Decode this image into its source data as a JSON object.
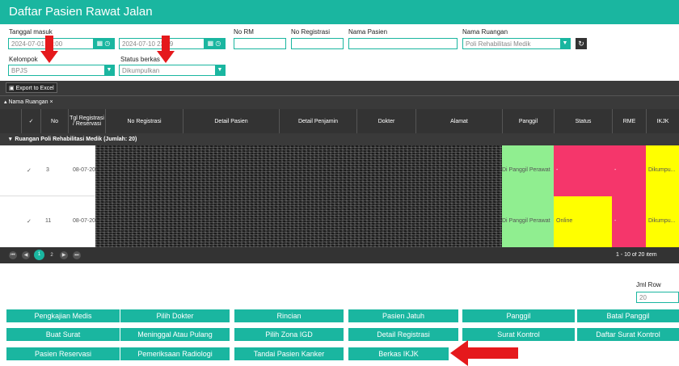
{
  "header": {
    "title": "Daftar Pasien Rawat Jalan"
  },
  "filters": {
    "tgl_masuk_label": "Tanggal masuk",
    "date_from": "2024-07-01 00:00",
    "date_to": "2024-07-10 23:59",
    "no_rm_label": "No RM",
    "no_reg_label": "No Registrasi",
    "nama_pasien_label": "Nama Pasien",
    "nama_ruangan_label": "Nama Ruangan",
    "nama_ruangan_value": "Poli Rehabilitasi Medik",
    "kelompok_label": "Kelompok",
    "kelompok_value": "BPJS",
    "status_berkas_label": "Status berkas",
    "status_berkas_value": "Dikumpulkan"
  },
  "toolbar": {
    "export_label": "Export to Excel"
  },
  "group": {
    "chip": "Nama Ruangan",
    "chip_close": "×",
    "group_row": "Ruangan Poli Rehabilitasi Medik (Jumlah: 20)"
  },
  "columns": [
    "No",
    "Tgl Registrasi / Reservasi",
    "No Registrasi",
    "Detail Pasien",
    "Detail Penjamin",
    "Dokter",
    "Alamat",
    "Panggil",
    "Status",
    "RME",
    "IKJK"
  ],
  "rows": [
    {
      "check": "✓",
      "no": "3",
      "tgl": "08-07-20",
      "panggil": "Di Panggil Perawat",
      "status": "-",
      "rme": "-",
      "ikjk": "Dikumpu..."
    },
    {
      "check": "✓",
      "no": "11",
      "tgl": "08-07-20",
      "panggil": "Di Panggil Perawat",
      "status": "Online",
      "rme": "-",
      "ikjk": "Dikumpu..."
    }
  ],
  "pager": {
    "pages": [
      "1",
      "2"
    ],
    "info": "1 - 10 of 20 item"
  },
  "jml_row": {
    "label": "Jml Row",
    "value": "20"
  },
  "buttons": [
    "Pengkajian Medis",
    "Pilih Dokter",
    "Rincian",
    "Pasien Jatuh",
    "Panggil",
    "Batal Panggil",
    "Buat Surat",
    "Meninggal Atau Pulang",
    "Pilih Zona IGD",
    "Detail Registrasi",
    "Surat Kontrol",
    "Daftar Surat Kontrol",
    "Pasien Reservasi",
    "Pemeriksaan Radiologi",
    "Tandai Pasien Kanker",
    "Berkas IKJK"
  ],
  "icons": {
    "calendar": "calendar-icon",
    "clock": "clock-icon",
    "dropdown": "chevron-down-icon",
    "refresh": "refresh-icon",
    "arrow": "red-arrow-annotation"
  },
  "colors": {
    "teal": "#1ab6a0",
    "green_cell": "#90ee90",
    "red_cell": "#f5366b",
    "yellow_cell": "#ffff00",
    "arrow": "#e5191c"
  }
}
